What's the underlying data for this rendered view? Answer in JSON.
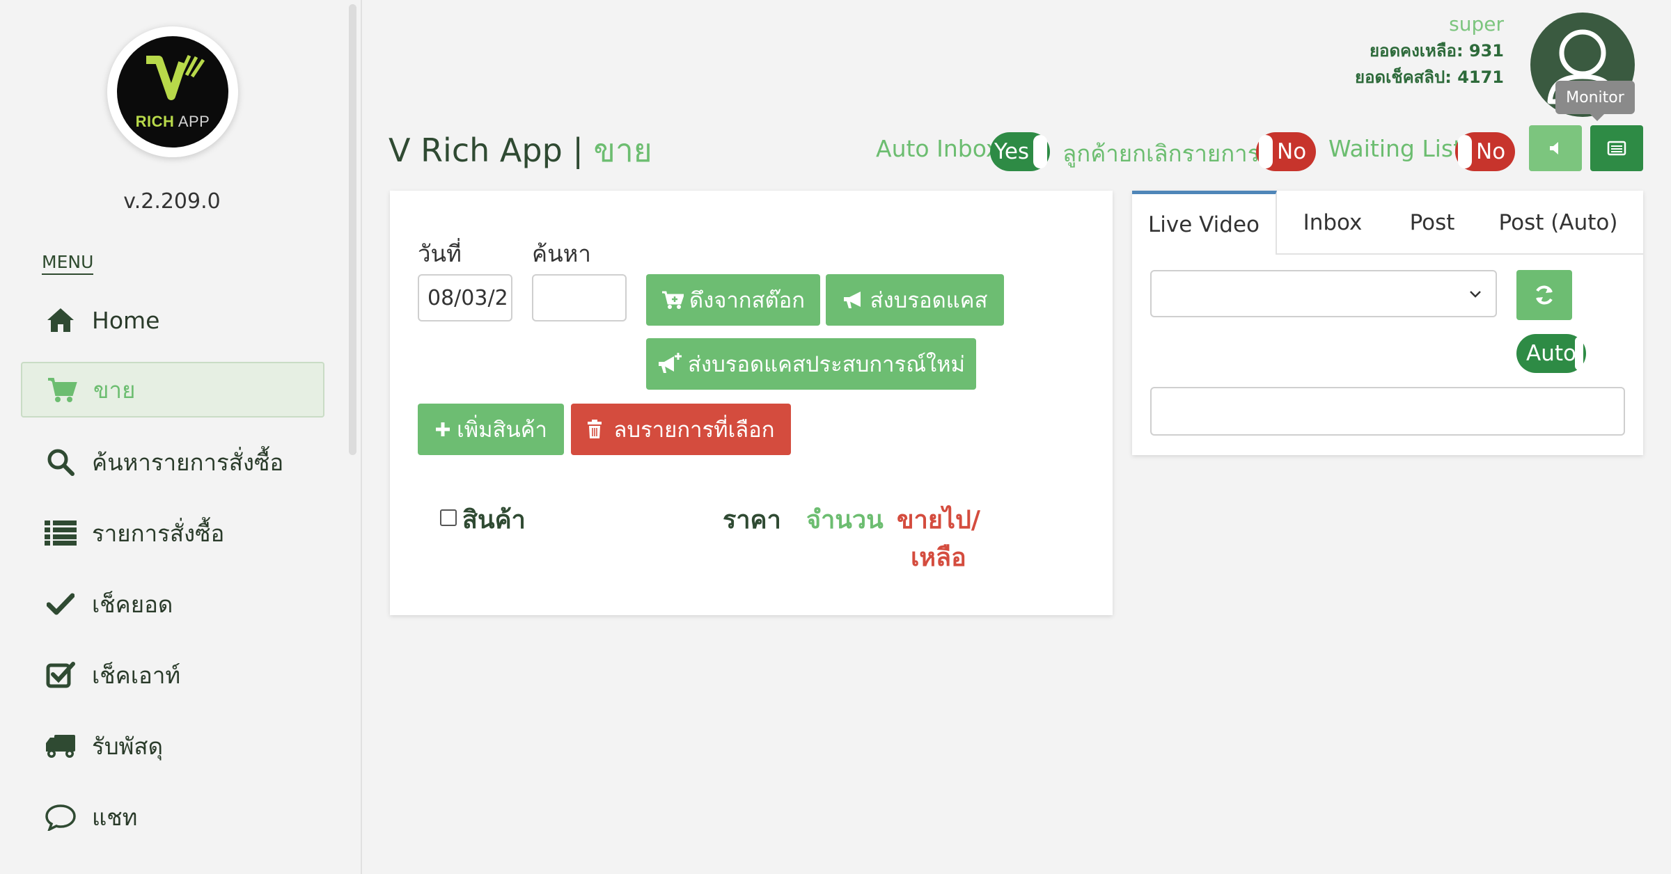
{
  "sidebar": {
    "logo": {
      "word": "RICH",
      "app": "APP"
    },
    "version": "v.2.209.0",
    "menu_label": "MENU",
    "items": [
      {
        "label": "Home",
        "icon": "home-icon"
      },
      {
        "label": "ขาย",
        "icon": "cart-icon",
        "active": true
      },
      {
        "label": "ค้นหารายการสั่งซื้อ",
        "icon": "search-icon"
      },
      {
        "label": "รายการสั่งซื้อ",
        "icon": "list-icon"
      },
      {
        "label": "เช็คยอด",
        "icon": "check-icon"
      },
      {
        "label": "เช็คเอาท์",
        "icon": "checkbox-icon"
      },
      {
        "label": "รับพัสดุ",
        "icon": "truck-icon"
      },
      {
        "label": "แชท",
        "icon": "chat-icon"
      }
    ]
  },
  "header": {
    "user_name": "super",
    "balance": "ยอดคงเหลือ: 931",
    "slip_count": "ยอดเช็คสลิป: 4171",
    "tooltip": "Monitor",
    "title_main": "V Rich App |",
    "title_sub": "ขาย",
    "toggles": [
      {
        "label": "Auto Inbox",
        "state": "Yes"
      },
      {
        "label": "ลูกค้ายกเลิกรายการ",
        "state": "No"
      },
      {
        "label": "Waiting List",
        "state": "No"
      }
    ]
  },
  "sale_panel": {
    "date_label": "วันที่",
    "date_value": "08/03/2",
    "search_label": "ค้นหา",
    "search_value": "",
    "btn_pull_stock": "ดึงจากสต๊อก",
    "btn_broadcast": "ส่งบรอดแคส",
    "btn_broadcast_new": "ส่งบรอดแคสประสบการณ์ใหม่",
    "btn_add_product": "เพิ่มสินค้า",
    "btn_delete_selected": "ลบรายการที่เลือก",
    "table_headers": {
      "product": "สินค้า",
      "price": "ราคา",
      "quantity": "จำนวน",
      "sold_line1": "ขายไป/",
      "sold_line2": "เหลือ"
    }
  },
  "live_panel": {
    "tabs": [
      "Live Video",
      "Inbox",
      "Post",
      "Post (Auto)"
    ],
    "active_tab": "Live Video",
    "select_value": "",
    "auto_label": "Auto",
    "text_value": ""
  },
  "colors": {
    "green": "#6dbd72",
    "dark_green": "#2e8b45",
    "red": "#d44c3e",
    "title": "#2f4a32",
    "tab_accent": "#4f86b8"
  }
}
